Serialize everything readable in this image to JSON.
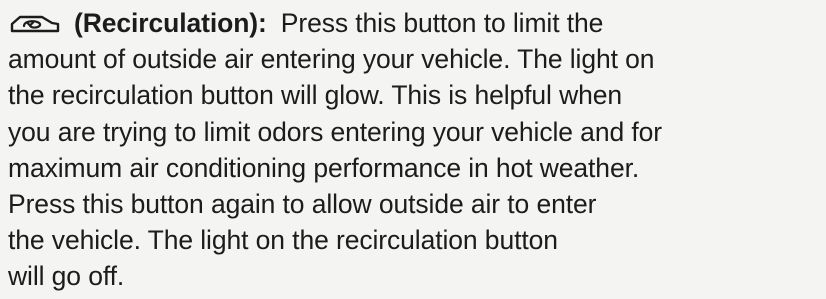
{
  "paragraph": {
    "icon": "recirculation-icon",
    "term": "(Recirculation):",
    "lines": [
      "Press this button to limit the",
      "amount of outside air entering your vehicle. The light on",
      "the recirculation button will glow. This is helpful when",
      "you are trying to limit odors entering your vehicle and for",
      "maximum air conditioning performance in hot weather.",
      "Press this button again to allow outside air to enter",
      "the vehicle. The light on the recirculation button",
      "will go off."
    ]
  },
  "colors": {
    "background": "#f4f4f2",
    "text": "#1c1c1c"
  }
}
